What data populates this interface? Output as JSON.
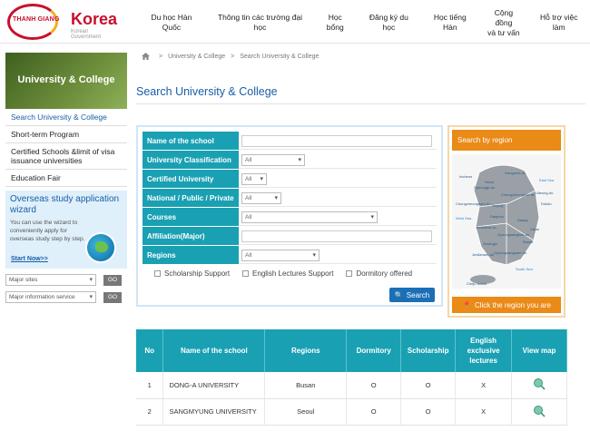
{
  "header": {
    "brand": "THANH GIANG",
    "logo_text": "Korea",
    "logo_subtext": "Korean Government",
    "nav": [
      {
        "label": "Du học Hàn Quốc"
      },
      {
        "label": "Thông tin các trường đại học"
      },
      {
        "label": "Học bổng"
      },
      {
        "label": "Đăng ký du học"
      },
      {
        "label": "Học tiếng Hàn"
      },
      {
        "label": "Cộng đồng\nvà tư vấn"
      },
      {
        "label": "Hỗ trợ việc làm"
      }
    ]
  },
  "sidebar": {
    "banner_title": "University & College",
    "menu": [
      {
        "label": "Search University & College"
      },
      {
        "label": "Short-term Program"
      },
      {
        "label": "Certified Schools &limit of visa issuance universities"
      },
      {
        "label": "Education Fair"
      }
    ],
    "wizard": {
      "title": "Overseas study application wizard",
      "desc": "You can use the wizard to conveniently apply for overseas study step by step.",
      "start": "Start Now>>"
    },
    "selects": [
      {
        "value": "Major sites",
        "go": "GO"
      },
      {
        "value": "Major information service",
        "go": "GO"
      }
    ]
  },
  "breadcrumb": [
    "University & College",
    "Search University & College"
  ],
  "page_title": "Search University & College",
  "form": {
    "fields": [
      {
        "label": "Name of the school",
        "type": "text",
        "value": ""
      },
      {
        "label": "University Classification",
        "type": "select",
        "value": "All"
      },
      {
        "label": "Certified University",
        "type": "select",
        "value": "All"
      },
      {
        "label": "National / Public / Private",
        "type": "select",
        "value": "All"
      },
      {
        "label": "Courses",
        "type": "select",
        "value": "All"
      },
      {
        "label": "Affiliation(Major)",
        "type": "text",
        "value": ""
      },
      {
        "label": "Regions",
        "type": "select",
        "value": "All"
      }
    ],
    "checkboxes": [
      "Scholarship Support",
      "English Lectures Support",
      "Dormitory offered"
    ],
    "search_button": "Search"
  },
  "region": {
    "title": "Search by region",
    "bottom": "Click the region you are",
    "map_labels": [
      "Incheon",
      "Seoul",
      "Gyeonggi-do",
      "Gangwon-do",
      "East Sea",
      "Chungcheongbuk-do",
      "Ulleung-do",
      "Chungcheongnam-do",
      "Sejong",
      "Dokdo",
      "West Sea",
      "Daejeon",
      "Daegu",
      "Jeollabuk-do",
      "Gyeongsangbuk-do",
      "Ulsan",
      "Gwangju",
      "Gyeongsangnam-do",
      "Busan",
      "Jeollanam-do",
      "South Sea",
      "Cheju Island"
    ]
  },
  "table": {
    "headers": [
      "No",
      "Name of the school",
      "Regions",
      "Dormitory",
      "Scholarship",
      "English exclusive lectures",
      "View map"
    ],
    "rows": [
      {
        "no": "1",
        "name": "DONG-A UNIVERSITY",
        "region": "Busan",
        "dorm": "O",
        "scholar": "O",
        "eng": "X"
      },
      {
        "no": "2",
        "name": "SANGMYUNG UNIVERSITY",
        "region": "Seoul",
        "dorm": "O",
        "scholar": "O",
        "eng": "X"
      }
    ]
  },
  "colors": {
    "accent": "#1aa0b3",
    "link": "#1a5ea8",
    "orange": "#ea8a17",
    "green": "#4a6c26"
  }
}
